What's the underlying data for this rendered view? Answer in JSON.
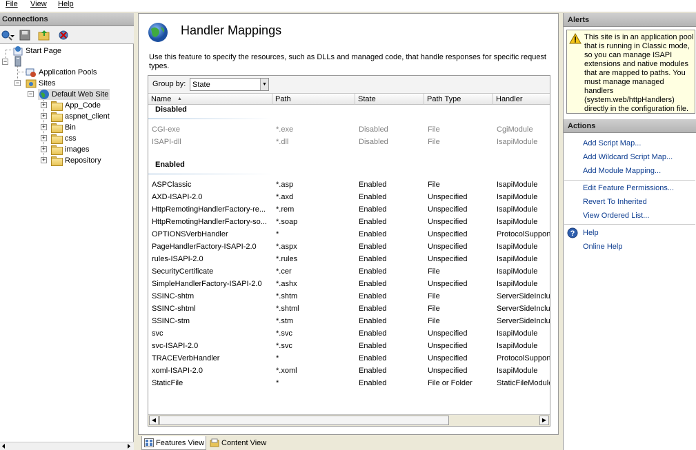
{
  "menu": [
    "File",
    "View",
    "Help"
  ],
  "connections": {
    "title": "Connections",
    "tree": {
      "start_page": "Start Page",
      "server": "",
      "app_pools": "Application Pools",
      "sites": "Sites",
      "default_site": "Default Web Site",
      "folders": [
        "App_Code",
        "aspnet_client",
        "Bin",
        "css",
        "images",
        "Repository"
      ]
    }
  },
  "main": {
    "title": "Handler Mappings",
    "description": "Use this feature to specify the resources, such as DLLs and managed code, that handle responses for specific request types.",
    "group_by_label": "Group by:",
    "group_by_value": "State",
    "columns": [
      "Name",
      "Path",
      "State",
      "Path Type",
      "Handler"
    ],
    "groups": [
      {
        "name": "Disabled",
        "rows": [
          [
            "CGI-exe",
            "*.exe",
            "Disabled",
            "File",
            "CgiModule"
          ],
          [
            "ISAPI-dll",
            "*.dll",
            "Disabled",
            "File",
            "IsapiModule"
          ]
        ]
      },
      {
        "name": "Enabled",
        "rows": [
          [
            "ASPClassic",
            "*.asp",
            "Enabled",
            "File",
            "IsapiModule"
          ],
          [
            "AXD-ISAPI-2.0",
            "*.axd",
            "Enabled",
            "Unspecified",
            "IsapiModule"
          ],
          [
            "HttpRemotingHandlerFactory-re...",
            "*.rem",
            "Enabled",
            "Unspecified",
            "IsapiModule"
          ],
          [
            "HttpRemotingHandlerFactory-so...",
            "*.soap",
            "Enabled",
            "Unspecified",
            "IsapiModule"
          ],
          [
            "OPTIONSVerbHandler",
            "*",
            "Enabled",
            "Unspecified",
            "ProtocolSupport"
          ],
          [
            "PageHandlerFactory-ISAPI-2.0",
            "*.aspx",
            "Enabled",
            "Unspecified",
            "IsapiModule"
          ],
          [
            "rules-ISAPI-2.0",
            "*.rules",
            "Enabled",
            "Unspecified",
            "IsapiModule"
          ],
          [
            "SecurityCertificate",
            "*.cer",
            "Enabled",
            "File",
            "IsapiModule"
          ],
          [
            "SimpleHandlerFactory-ISAPI-2.0",
            "*.ashx",
            "Enabled",
            "Unspecified",
            "IsapiModule"
          ],
          [
            "SSINC-shtm",
            "*.shtm",
            "Enabled",
            "File",
            "ServerSideInclu"
          ],
          [
            "SSINC-shtml",
            "*.shtml",
            "Enabled",
            "File",
            "ServerSideInclu"
          ],
          [
            "SSINC-stm",
            "*.stm",
            "Enabled",
            "File",
            "ServerSideInclu"
          ],
          [
            "svc",
            "*.svc",
            "Enabled",
            "Unspecified",
            "IsapiModule"
          ],
          [
            "svc-ISAPI-2.0",
            "*.svc",
            "Enabled",
            "Unspecified",
            "IsapiModule"
          ],
          [
            "TRACEVerbHandler",
            "*",
            "Enabled",
            "Unspecified",
            "ProtocolSupport"
          ],
          [
            "xoml-ISAPI-2.0",
            "*.xoml",
            "Enabled",
            "Unspecified",
            "IsapiModule"
          ],
          [
            "StaticFile",
            "*",
            "Enabled",
            "File or Folder",
            "StaticFileModule"
          ]
        ]
      }
    ]
  },
  "tabs": {
    "features": "Features View",
    "content": "Content View"
  },
  "alerts": {
    "title": "Alerts",
    "text": "This site is in an application pool that is running in Classic mode, so you can manage ISAPI extensions and native modules that are mapped to paths. You must manage managed handlers (system.web/httpHandlers) directly in the configuration file."
  },
  "actions": {
    "title": "Actions",
    "items": [
      "Add Script Map...",
      "Add Wildcard Script Map...",
      "Add Module Mapping...",
      "Edit Feature Permissions...",
      "Revert To Inherited",
      "View Ordered List...",
      "Help",
      "Online Help"
    ]
  },
  "colors": {
    "link": "#0c3c90",
    "alert_bg": "#ffffe1",
    "disabled_text": "#808080"
  }
}
